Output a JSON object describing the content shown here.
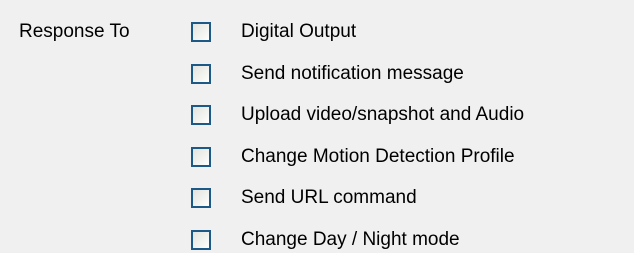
{
  "panel": {
    "label": "Response To",
    "options": [
      {
        "label": "Digital Output",
        "checked": false
      },
      {
        "label": "Send notification message",
        "checked": false
      },
      {
        "label": "Upload video/snapshot and Audio",
        "checked": false
      },
      {
        "label": "Change Motion Detection Profile",
        "checked": false
      },
      {
        "label": "Send URL command",
        "checked": false
      },
      {
        "label": "Change Day / Night mode",
        "checked": false
      }
    ]
  },
  "colors": {
    "background": "#f0f0f0",
    "checkbox_border": "#1d5987"
  }
}
